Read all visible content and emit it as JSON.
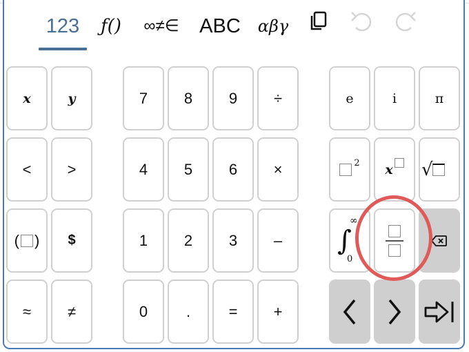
{
  "tabs": [
    {
      "label": "123",
      "active": true
    },
    {
      "label": "ƒ()",
      "active": false
    },
    {
      "label": "∞≠∈",
      "active": false
    },
    {
      "label": "ABC",
      "active": false
    },
    {
      "label": "αβγ",
      "active": false
    }
  ],
  "toolbar_icons": [
    "copy-icon",
    "undo-icon",
    "redo-icon"
  ],
  "keys": {
    "var_x": "x",
    "var_y": "y",
    "less": "<",
    "greater": ">",
    "paren_open": "(",
    "paren_close": ")",
    "dollar": "$",
    "approx": "≈",
    "notequal": "≠",
    "d7": "7",
    "d8": "8",
    "d9": "9",
    "divide": "÷",
    "d4": "4",
    "d5": "5",
    "d6": "6",
    "times": "×",
    "d1": "1",
    "d2": "2",
    "d3": "3",
    "minus": "–",
    "d0": "0",
    "dot": ".",
    "equals": "=",
    "plus": "+",
    "e": "e",
    "i": "i",
    "pi": "π",
    "square_exp": "2",
    "integral_upper": "∞",
    "integral_lower": "0",
    "integral_sign": "∫",
    "sqrt_sign": "√"
  },
  "colors": {
    "accent": "#4a6f95",
    "frame": "#4a7ab8",
    "highlight": "#e05a5a",
    "gray_key": "#cfcfcf"
  }
}
